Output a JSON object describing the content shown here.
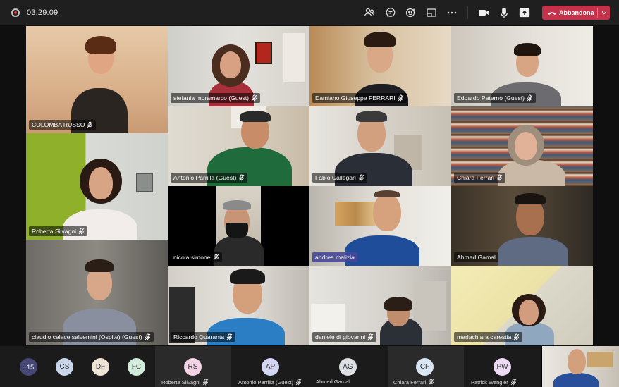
{
  "topbar": {
    "timer": "03:29:09",
    "icons": [
      "record-icon",
      "participants-icon",
      "chat-icon",
      "reactions-icon",
      "share-tray-icon",
      "more-icon",
      "camera-icon",
      "microphone-icon",
      "share-screen-icon"
    ],
    "leave_label": "Abbandona",
    "leave_color": "#c4314b"
  },
  "tiles": [
    {
      "name": "COLOMBA RUSSO",
      "active": false
    },
    {
      "name": "stefania moramarco (Guest)",
      "active": false
    },
    {
      "name": "Damiano Giuseppe FERRARI",
      "active": false
    },
    {
      "name": "Edoardo Paternò (Guest)",
      "active": false
    },
    {
      "name": "Antonio Parrilla (Guest)",
      "active": false
    },
    {
      "name": "Fabio Callegari",
      "active": false
    },
    {
      "name": "Chiara Ferrari",
      "active": false
    },
    {
      "name": "Roberta Silvagni",
      "active": false
    },
    {
      "name": "nicola simone",
      "active": false
    },
    {
      "name": "andrea malizia",
      "active": true
    },
    {
      "name": "Ahmed Gamal",
      "active": false
    },
    {
      "name": "claudio calace salvemini (Ospite) (Guest)",
      "active": false
    },
    {
      "name": "Riccardo Quaranta",
      "active": false
    },
    {
      "name": "daniele di giovanni",
      "active": false
    },
    {
      "name": "mariachiara carestia",
      "active": false
    }
  ],
  "bottombar": {
    "overflow": {
      "initials": "+15",
      "color": "#464775"
    },
    "avatars": [
      {
        "initials": "CS",
        "color": "#c9d6ea"
      },
      {
        "initials": "DF",
        "color": "#ede4d6"
      },
      {
        "initials": "FC",
        "color": "#d2eddc"
      }
    ],
    "cards": [
      {
        "initials": "RS",
        "name": "Roberta Silvagni",
        "color": "#f3d3e6",
        "muted": true
      },
      {
        "initials": "AP",
        "name": "Antonio Parrilla (Guest)",
        "color": "#d3d6f3",
        "muted": true
      },
      {
        "initials": "AG",
        "name": "Ahmed Gamal",
        "color": "#dcdfe3",
        "muted": false
      },
      {
        "initials": "CF",
        "name": "Chiara Ferrari",
        "color": "#d8e6f3",
        "muted": true
      },
      {
        "initials": "PW",
        "name": "Patrick Wengler",
        "color": "#ecdaf3",
        "muted": true
      }
    ]
  }
}
